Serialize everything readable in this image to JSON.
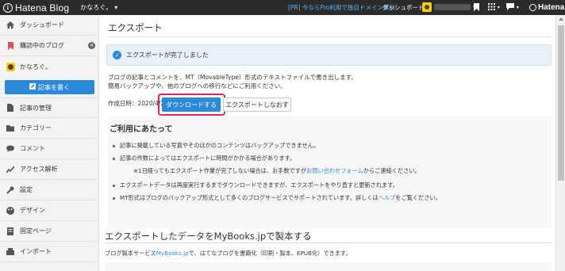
{
  "topbar": {
    "logo": "Hatena Blog",
    "blog_name": "かなろぐ。",
    "blog_caret": "▾",
    "promo": "[PR] 今ならPro利用で独自ドメイン無料",
    "dashboard": "ダッシュボード",
    "hatena": "Hatena"
  },
  "sidebar": {
    "items": [
      {
        "label": "ダッシュボード",
        "icon": "home-icon"
      },
      {
        "label": "購読中のブログ",
        "icon": "bookmark-icon",
        "badge": "4"
      },
      {
        "label": "かなろぐ。",
        "icon": "avatar"
      },
      {
        "label": "記事の管理",
        "icon": "document-icon"
      },
      {
        "label": "カテゴリー",
        "icon": "folder-icon"
      },
      {
        "label": "コメント",
        "icon": "comment-icon"
      },
      {
        "label": "アクセス解析",
        "icon": "chart-icon"
      },
      {
        "label": "設定",
        "icon": "wrench-icon"
      },
      {
        "label": "デザイン",
        "icon": "palette-icon"
      },
      {
        "label": "固定ページ",
        "icon": "page-icon"
      },
      {
        "label": "インポート",
        "icon": "import-icon"
      }
    ],
    "write_button": "記事を書く"
  },
  "main": {
    "title": "エクスポート",
    "alert": "エクスポートが完了しました",
    "desc_line1": "ブログの記事とコメントを、MT（MovableType）形式のテキストファイルで書き出します。",
    "desc_line2": "簡易バックアップや、他のブログへの移行などにご利用ください。",
    "created_label": "作成日時：2020/4/25",
    "download_button": "ダウンロードする",
    "reexport_button": "エクスポートしなおす",
    "notes_title": "ご利用にあたって",
    "notes": {
      "n1": "記事に掲載している写真やそのほかのコンテンツはバックアップできません。",
      "n2": "記事の件数によってはエクスポートに時間がかかる場合があります。",
      "n3_pre": "※1日経ってもエクスポート作業が完了しない場合は、お手数ですが",
      "n3_link": "お問い合わせフォーム",
      "n3_post": "からご連絡ください。",
      "n4": "エクスポートデータは再度実行するまでダウンロードできますが、エクスポートをやり直すと更新されます。",
      "n5_pre": "MT形式はブログのバックアップ形式として多くのブログサービスでサポートされています。詳しくは",
      "n5_link": "ヘルプ",
      "n5_post": "をご覧ください。"
    },
    "section2_title": "エクスポートしたデータをMyBooks.jpで製本する",
    "section2_desc_pre": "ブログ製本サービス",
    "section2_desc_link": "MyBooks.jp",
    "section2_desc_post": "で、はてなブログを書籍化（印刷・製本、EPUB化）できます。"
  }
}
